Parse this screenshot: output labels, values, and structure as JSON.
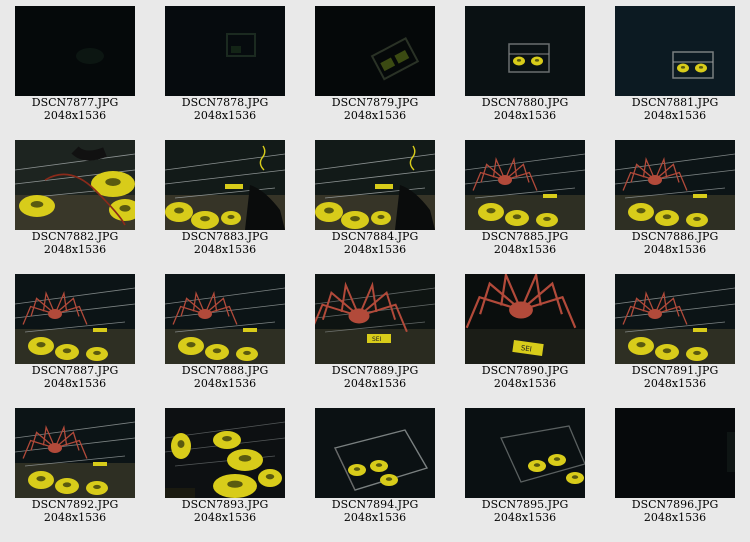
{
  "gallery": {
    "items": [
      {
        "filename": "DSCN7877.JPG",
        "dimensions": "2048x1536",
        "scene": "dark-empty",
        "description_icon": "photo-thumbnail-icon"
      },
      {
        "filename": "DSCN7878.JPG",
        "dimensions": "2048x1536",
        "scene": "dark-frame-faint",
        "description_icon": "photo-thumbnail-icon"
      },
      {
        "filename": "DSCN7879.JPG",
        "dimensions": "2048x1536",
        "scene": "dark-frame-tilted",
        "description_icon": "photo-thumbnail-icon"
      },
      {
        "filename": "DSCN7880.JPG",
        "dimensions": "2048x1536",
        "scene": "frame-distant",
        "description_icon": "photo-thumbnail-icon"
      },
      {
        "filename": "DSCN7881.JPG",
        "dimensions": "2048x1536",
        "scene": "frame-distant-blue",
        "description_icon": "photo-thumbnail-icon"
      },
      {
        "filename": "DSCN7882.JPG",
        "dimensions": "2048x1536",
        "scene": "closeup-floats",
        "description_icon": "photo-thumbnail-icon"
      },
      {
        "filename": "DSCN7883.JPG",
        "dimensions": "2048x1536",
        "scene": "closeup-rig",
        "description_icon": "photo-thumbnail-icon"
      },
      {
        "filename": "DSCN7884.JPG",
        "dimensions": "2048x1536",
        "scene": "closeup-rig",
        "description_icon": "photo-thumbnail-icon"
      },
      {
        "filename": "DSCN7885.JPG",
        "dimensions": "2048x1536",
        "scene": "crab-on-rig",
        "description_icon": "photo-thumbnail-icon"
      },
      {
        "filename": "DSCN7886.JPG",
        "dimensions": "2048x1536",
        "scene": "crab-on-rig",
        "description_icon": "photo-thumbnail-icon"
      },
      {
        "filename": "DSCN7887.JPG",
        "dimensions": "2048x1536",
        "scene": "crab-on-rig",
        "description_icon": "photo-thumbnail-icon"
      },
      {
        "filename": "DSCN7888.JPG",
        "dimensions": "2048x1536",
        "scene": "crab-on-rig",
        "description_icon": "photo-thumbnail-icon"
      },
      {
        "filename": "DSCN7889.JPG",
        "dimensions": "2048x1536",
        "scene": "crab-closeup",
        "description_icon": "photo-thumbnail-icon"
      },
      {
        "filename": "DSCN7890.JPG",
        "dimensions": "2048x1536",
        "scene": "crab-closeup-dark",
        "description_icon": "photo-thumbnail-icon"
      },
      {
        "filename": "DSCN7891.JPG",
        "dimensions": "2048x1536",
        "scene": "crab-on-rig",
        "description_icon": "photo-thumbnail-icon"
      },
      {
        "filename": "DSCN7892.JPG",
        "dimensions": "2048x1536",
        "scene": "crab-on-rig",
        "description_icon": "photo-thumbnail-icon"
      },
      {
        "filename": "DSCN7893.JPG",
        "dimensions": "2048x1536",
        "scene": "floats-oblique",
        "description_icon": "photo-thumbnail-icon"
      },
      {
        "filename": "DSCN7894.JPG",
        "dimensions": "2048x1536",
        "scene": "frame-receding",
        "description_icon": "photo-thumbnail-icon"
      },
      {
        "filename": "DSCN7895.JPG",
        "dimensions": "2048x1536",
        "scene": "frame-receding-dim",
        "description_icon": "photo-thumbnail-icon"
      },
      {
        "filename": "DSCN7896.JPG",
        "dimensions": "2048x1536",
        "scene": "dark-empty-edge",
        "description_icon": "photo-thumbnail-icon"
      }
    ]
  },
  "colors": {
    "page_background": "#e9e9e9",
    "caption_text": "#000000",
    "float_yellow": "#d8cc1a",
    "crab_red": "#b24a3a",
    "water_dark": "#05080a"
  }
}
